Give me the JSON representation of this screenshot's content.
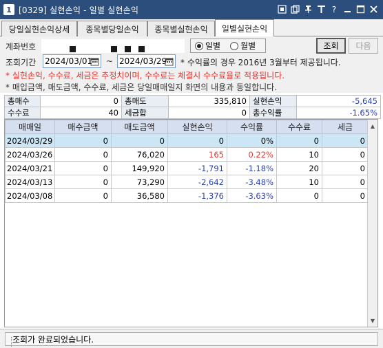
{
  "window": {
    "number": "1",
    "title": "[0329] 실현손익 - 일별 실현손익"
  },
  "tabs": [
    {
      "label": "당일실현손익상세"
    },
    {
      "label": "종목별당일손익"
    },
    {
      "label": "종목별실현손익"
    },
    {
      "label": "일별실현손익",
      "active": true
    }
  ],
  "query": {
    "account_label": "계좌번호",
    "period_label": "조회기간",
    "radio_daily": "일별",
    "radio_monthly": "월별",
    "radio_selected": "일별",
    "search_button": "조회",
    "next_button": "다음",
    "start_date": "2024/03/01",
    "end_date": "2024/03/29",
    "tilde": "~",
    "rate_note": "* 수익률의 경우 2016년 3월부터 제공됩니다.",
    "note_red": "* 실현손익, 수수료, 세금은 추정치이며, 수수료는 체결시 수수료율로 적용됩니다.",
    "note_dark": "* 매입금액, 매도금액, 수수료, 세금은 당일매매일지 화면의 내용과 동일합니다."
  },
  "summary": {
    "row1": [
      {
        "label": "총매수",
        "value": "0"
      },
      {
        "label": "총매도",
        "value": "335,810"
      },
      {
        "label": "실현손익",
        "value": "-5,645"
      }
    ],
    "row2": [
      {
        "label": "수수료",
        "value": "40"
      },
      {
        "label": "세금합",
        "value": "0"
      },
      {
        "label": "총수익률",
        "value": "-1.65%"
      }
    ]
  },
  "grid": {
    "headers": [
      "매매일",
      "매수금액",
      "매도금액",
      "실현손익",
      "수익률",
      "수수료",
      "세금"
    ],
    "rows": [
      {
        "date": "2024/03/29",
        "buy": "0",
        "sell": "0",
        "pnl": "0",
        "rate": "0%",
        "fee": "0",
        "tax": "0",
        "tone": "zero"
      },
      {
        "date": "2024/03/26",
        "buy": "0",
        "sell": "76,020",
        "pnl": "165",
        "rate": "0.22%",
        "fee": "10",
        "tax": "0",
        "tone": "pos"
      },
      {
        "date": "2024/03/21",
        "buy": "0",
        "sell": "149,920",
        "pnl": "-1,791",
        "rate": "-1.18%",
        "fee": "20",
        "tax": "0",
        "tone": "neg"
      },
      {
        "date": "2024/03/13",
        "buy": "0",
        "sell": "73,290",
        "pnl": "-2,642",
        "rate": "-3.48%",
        "fee": "10",
        "tax": "0",
        "tone": "neg"
      },
      {
        "date": "2024/03/08",
        "buy": "0",
        "sell": "36,580",
        "pnl": "-1,376",
        "rate": "-3.63%",
        "fee": "0",
        "tax": "0",
        "tone": "neg"
      }
    ]
  },
  "status": {
    "message": "조회가 완료되었습니다."
  },
  "icons": [
    "window-number-icon",
    "link-icon",
    "copy-icon",
    "pin-icon",
    "text-icon",
    "help-icon",
    "minimize-icon",
    "maximize-icon",
    "close-icon",
    "calendar-icon",
    "scroll-up-icon",
    "scroll-down-icon"
  ],
  "colors": {
    "title_bar": "#2c4e7c",
    "grid_header": "#d5dff0",
    "selected_row": "#cde6f5",
    "positive": "#e3342f",
    "negative": "#2a3fb0"
  }
}
